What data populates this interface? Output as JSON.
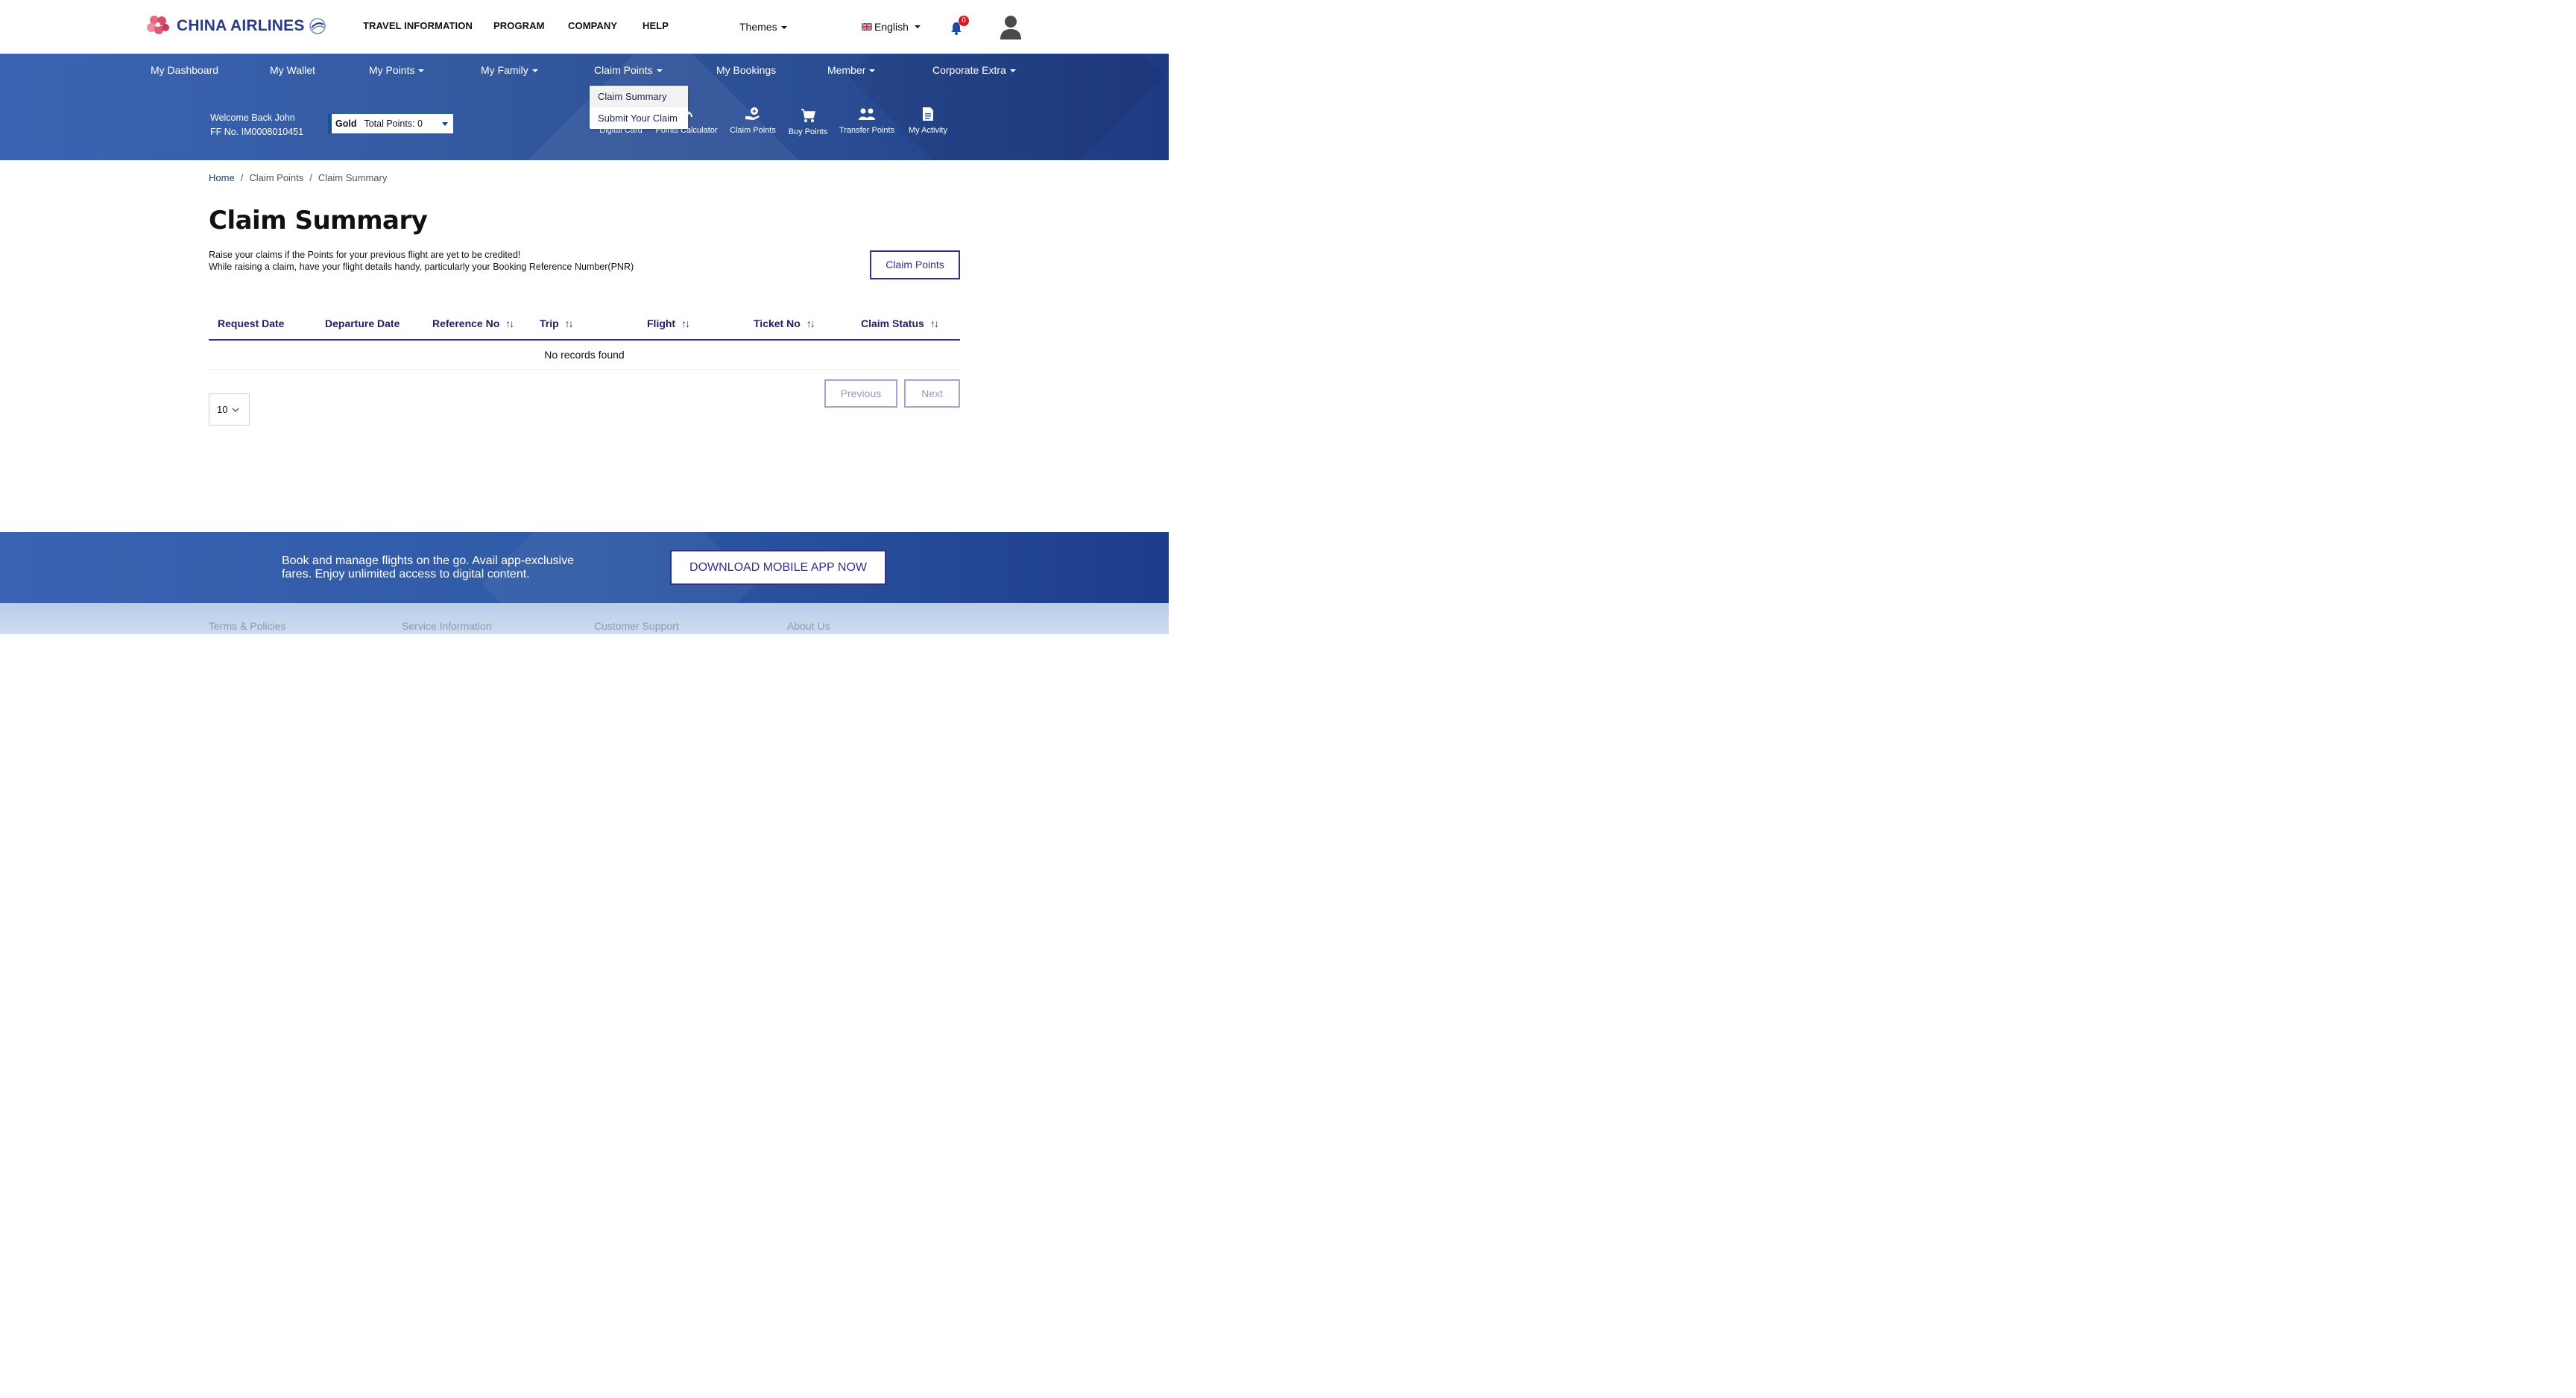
{
  "brand": {
    "name": "CHINA AIRLINES"
  },
  "topnav": [
    "TRAVEL INFORMATION",
    "PROGRAM",
    "COMPANY",
    "HELP"
  ],
  "themes_label": "Themes",
  "language": {
    "label": "English",
    "flag": "uk-flag-icon"
  },
  "notifications": {
    "count": "0"
  },
  "mainnav": {
    "dashboard": "My Dashboard",
    "wallet": "My Wallet",
    "points": "My Points",
    "family": "My Family",
    "claim": "Claim Points",
    "bookings": "My Bookings",
    "member": "Member",
    "corporate": "Corporate Extra"
  },
  "dropdown": {
    "items": [
      "Claim Summary",
      "Submit Your Claim"
    ]
  },
  "user": {
    "welcome": "Welcome Back John",
    "ffno": "FF No. IM0008010451",
    "tier": "Gold",
    "points": "Total Points: 0"
  },
  "quick_links": [
    "Digital Card",
    "Points Calculator",
    "Claim Points",
    "Buy Points",
    "Transfer Points",
    "My Activity"
  ],
  "breadcrumb": [
    "Home",
    "Claim Points",
    "Claim Summary"
  ],
  "page": {
    "title": "Claim Summary",
    "desc1": "Raise your claims if the Points for your previous flight are yet to be credited!",
    "desc2": "While raising a claim, have your flight details handy, particularly your Booking Reference Number(PNR)",
    "claim_button": "Claim Points"
  },
  "table": {
    "columns": [
      "Request Date",
      "Departure Date",
      "Reference No",
      "Trip",
      "Flight",
      "Ticket No",
      "Claim Status"
    ],
    "empty": "No records found",
    "per_page": "10",
    "prev": "Previous",
    "next": "Next"
  },
  "promo": {
    "line1": "Book and manage flights on the go. Avail app-exclusive",
    "line2": "fares. Enjoy unlimited access to digital content.",
    "button": "DOWNLOAD MOBILE APP NOW"
  },
  "footer": [
    "Terms & Policies",
    "Service Information",
    "Customer Support",
    "About Us"
  ],
  "colors": {
    "band": "#3b64b4",
    "accent": "#2e3192",
    "header_text": "#2a1a5e"
  }
}
